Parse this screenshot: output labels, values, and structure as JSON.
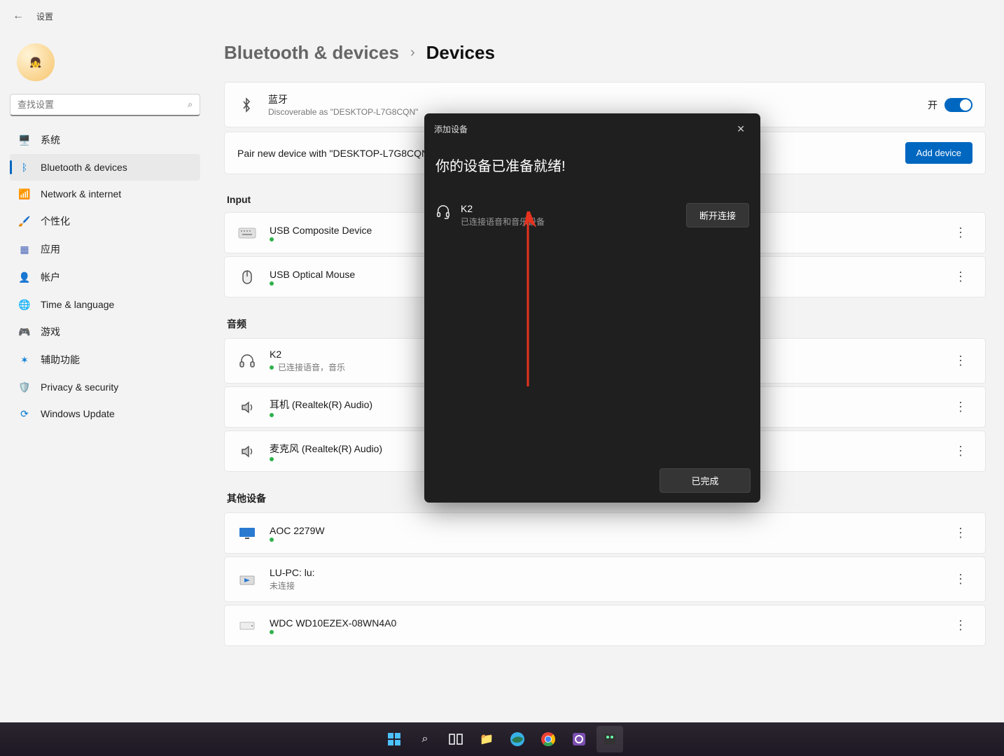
{
  "app_title": "设置",
  "search_placeholder": "查找设置",
  "nav": [
    {
      "icon": "🖥️",
      "label": "系统",
      "color": "#0078d4"
    },
    {
      "icon": "ᛒ",
      "label": "Bluetooth & devices",
      "color": "#0078d4",
      "active": true
    },
    {
      "icon": "📶",
      "label": "Network & internet",
      "color": "#0078d4"
    },
    {
      "icon": "🖌️",
      "label": "个性化",
      "color": "#d96f00"
    },
    {
      "icon": "▦",
      "label": "应用",
      "color": "#4563b8"
    },
    {
      "icon": "👤",
      "label": "帐户",
      "color": "#2a9b3e"
    },
    {
      "icon": "🌐",
      "label": "Time & language",
      "color": "#2a88c9"
    },
    {
      "icon": "🎮",
      "label": "游戏",
      "color": "#777"
    },
    {
      "icon": "✶",
      "label": "辅助功能",
      "color": "#0078d4"
    },
    {
      "icon": "🛡️",
      "label": "Privacy & security",
      "color": "#888"
    },
    {
      "icon": "⟳",
      "label": "Windows Update",
      "color": "#0078d4"
    }
  ],
  "breadcrumb": {
    "parent": "Bluetooth & devices",
    "current": "Devices"
  },
  "bluetooth_card": {
    "title": "蓝牙",
    "subtitle": "Discoverable as \"DESKTOP-L7G8CQN\"",
    "toggle_label": "开"
  },
  "pair_card": {
    "text": "Pair new device with \"DESKTOP-L7G8CQN\"",
    "button": "Add device"
  },
  "sections": [
    {
      "title": "Input",
      "devices": [
        {
          "name": "USB Composite Device",
          "status": "",
          "icon": "keyboard"
        },
        {
          "name": "USB Optical Mouse",
          "status": "",
          "icon": "mouse"
        }
      ]
    },
    {
      "title": "音频",
      "devices": [
        {
          "name": "K2",
          "status": "已连接语音，音乐",
          "icon": "headphones"
        },
        {
          "name": "耳机 (Realtek(R) Audio)",
          "status": "",
          "icon": "speaker"
        },
        {
          "name": "麦克风 (Realtek(R) Audio)",
          "status": "",
          "icon": "speaker"
        }
      ]
    },
    {
      "title": "其他设备",
      "devices": [
        {
          "name": "AOC 2279W",
          "status": "",
          "icon": "monitor"
        },
        {
          "name": "LU-PC: lu:",
          "status": "未连接",
          "icon": "media",
          "nodot": true
        },
        {
          "name": "WDC WD10EZEX-08WN4A0",
          "status": "",
          "icon": "drive"
        }
      ]
    }
  ],
  "dialog": {
    "header": "添加设备",
    "heading": "你的设备已准备就绪!",
    "device_name": "K2",
    "device_status": "已连接语音和音乐设备",
    "disconnect": "断开连接",
    "done": "已完成"
  }
}
